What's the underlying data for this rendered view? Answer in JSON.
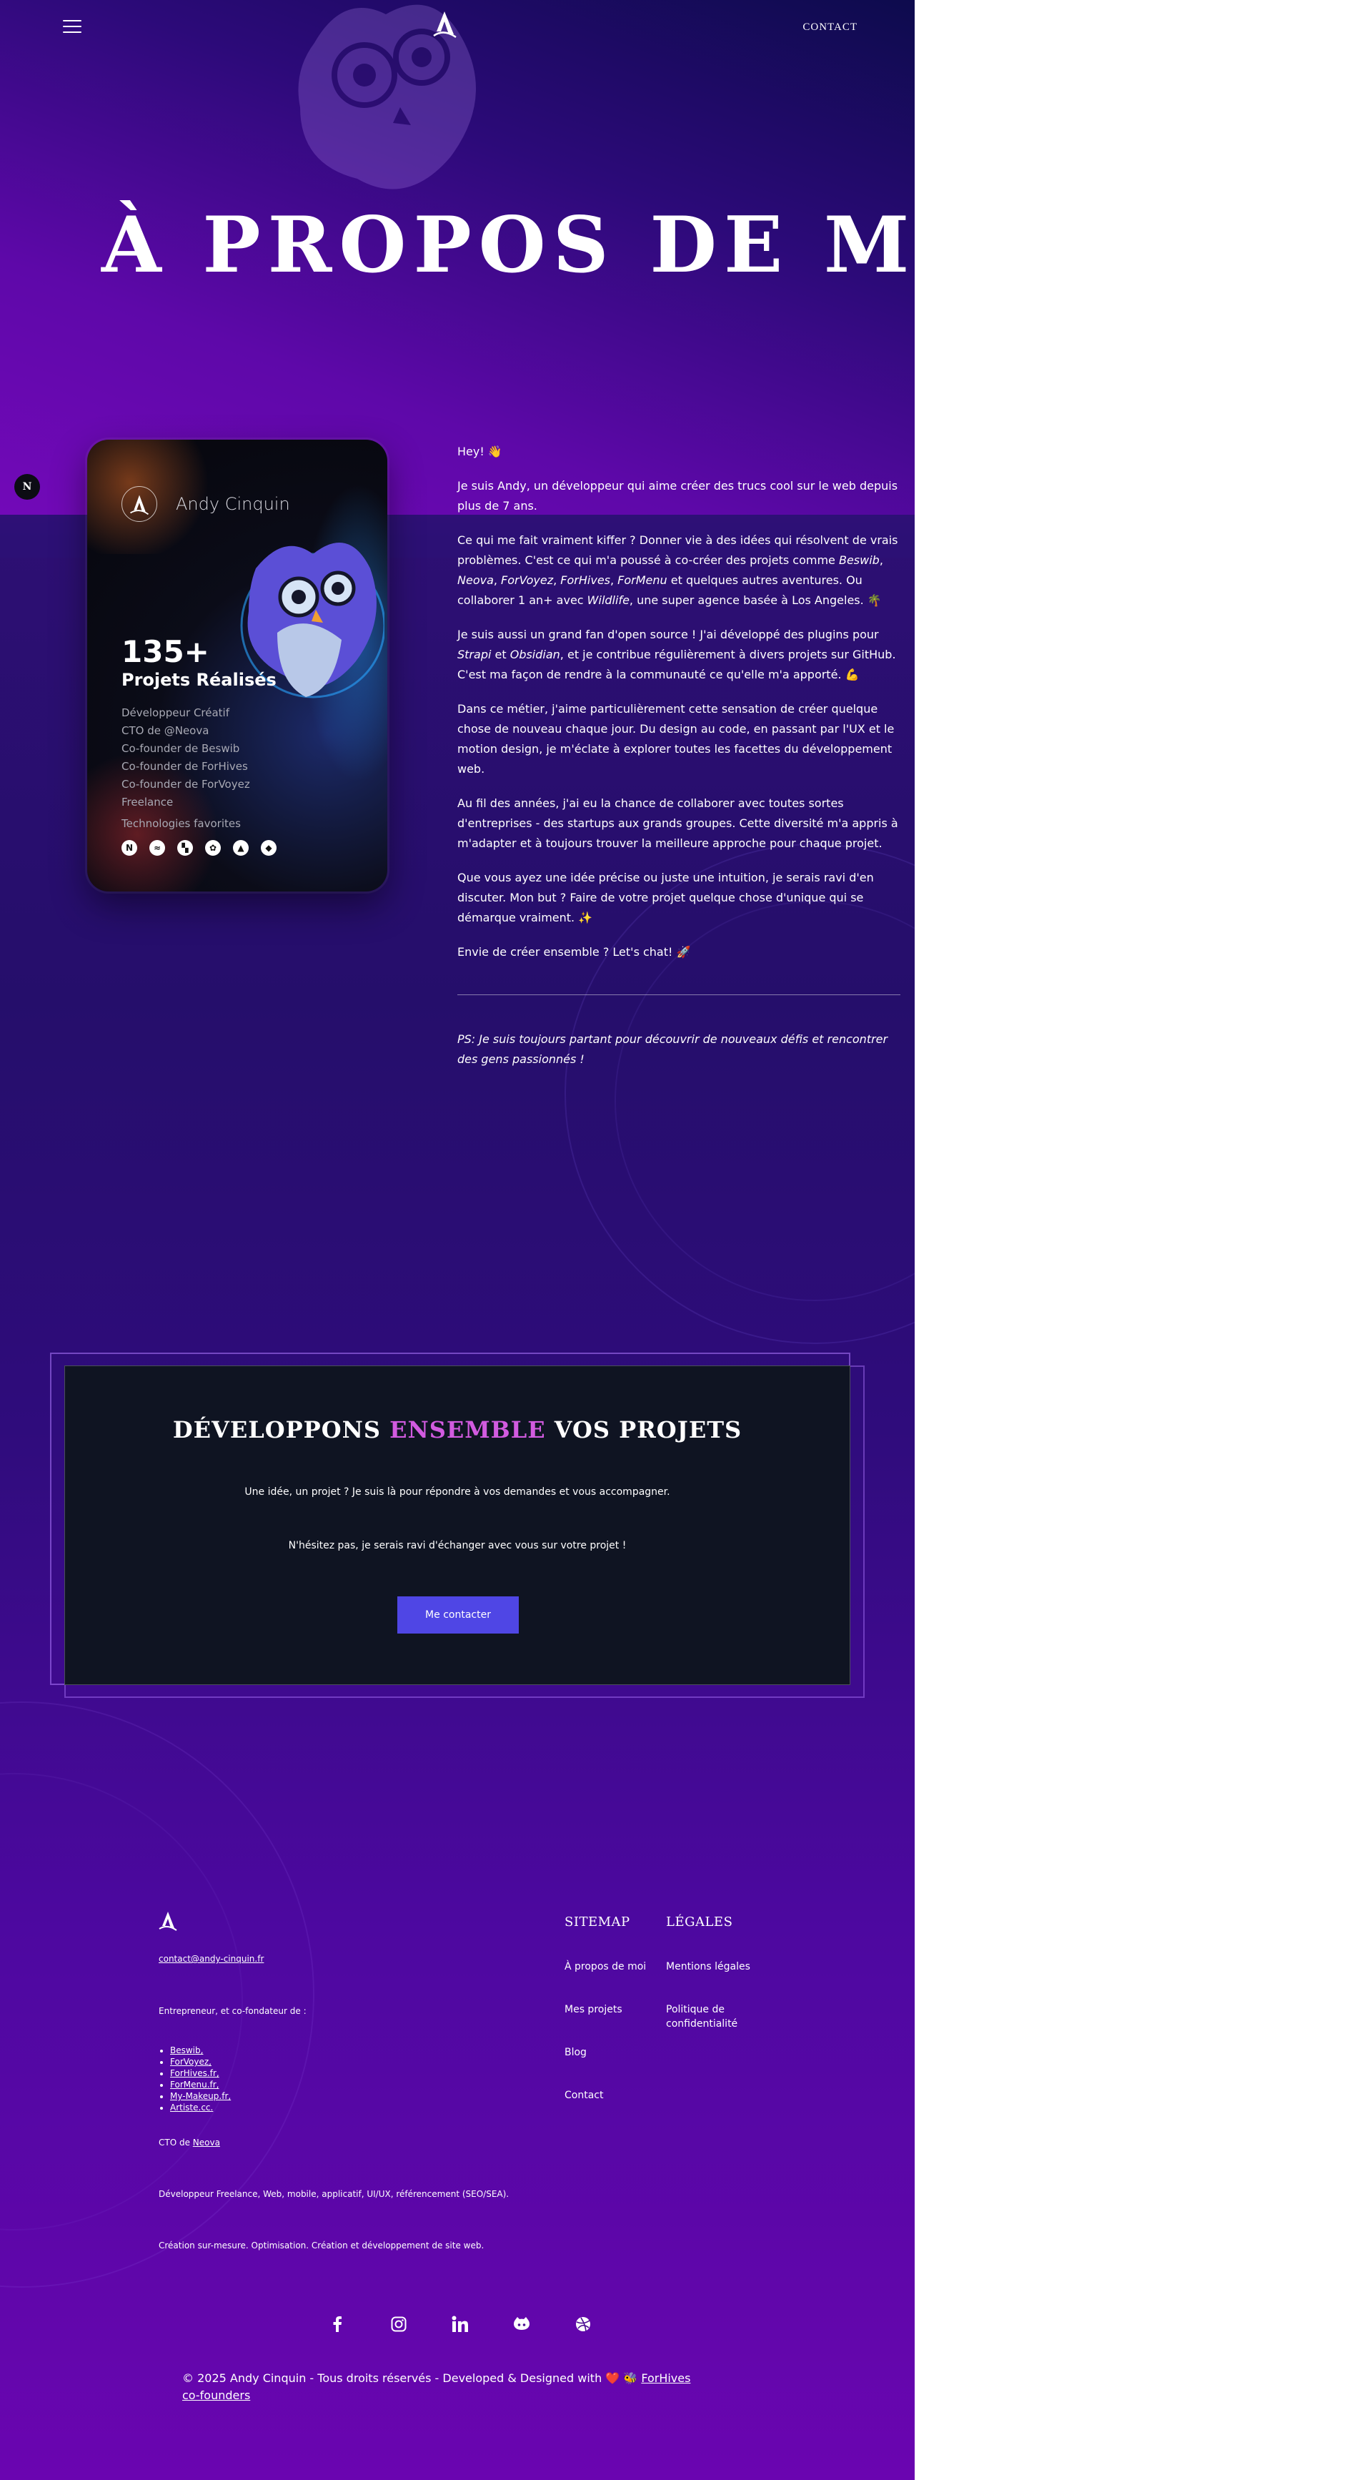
{
  "header": {
    "contact_label": "CONTACT"
  },
  "hero": {
    "title": "À PROPOS DE MOI"
  },
  "side_badge": {
    "label": "N"
  },
  "card": {
    "name": "Andy Cinquin",
    "count": "135+",
    "count_label": "Projets Réalisés",
    "roles": [
      "Développeur Créatif",
      "CTO de @Neova",
      "Co-founder de Beswib",
      "Co-founder de ForHives",
      "Co-founder de ForVoyez",
      "Freelance"
    ],
    "tech_label": "Technologies favorites",
    "tech_icons": [
      "nextjs-icon",
      "tailwind-icon",
      "strapi-icon",
      "openai-icon",
      "nuxt-icon",
      "prisma-icon"
    ]
  },
  "about": {
    "p1": "Hey! 👋",
    "p2": "Je suis Andy, un développeur qui aime créer des trucs cool sur le web depuis plus de 7 ans.",
    "p3_a": "Ce qui me fait vraiment kiffer ? Donner vie à des idées qui résolvent de vrais problèmes. C'est ce qui m'a poussé à co-créer des projets comme ",
    "p3_beswib": "Beswib",
    "p3_comma1": ", ",
    "p3_neova": "Neova",
    "p3_comma2": ", ",
    "p3_forvoyez": "ForVoyez",
    "p3_comma3": ", ",
    "p3_forhives": "ForHives",
    "p3_comma4": ", ",
    "p3_formenu": "ForMenu",
    "p3_b": " et quelques autres aventures. Ou collaborer 1 an+ avec ",
    "p3_wildlife": "Wildlife",
    "p3_c": ", une super agence basée à Los Angeles. 🌴",
    "p4_a": "Je suis aussi un grand fan d'open source ! J'ai développé des plugins pour ",
    "p4_strapi": "Strapi",
    "p4_b": " et ",
    "p4_obsidian": "Obsidian",
    "p4_c": ", et je contribue régulièrement à divers projets sur GitHub. C'est ma façon de rendre à la communauté ce qu'elle m'a apporté. 💪",
    "p5": "Dans ce métier, j'aime particulièrement cette sensation de créer quelque chose de nouveau chaque jour. Du design au code, en passant par l'UX et le motion design, je m'éclate à explorer toutes les facettes du développement web.",
    "p6": "Au fil des années, j'ai eu la chance de collaborer avec toutes sortes d'entreprises - des startups aux grands groupes. Cette diversité m'a appris à m'adapter et à toujours trouver la meilleure approche pour chaque projet.",
    "p7": "Que vous ayez une idée précise ou juste une intuition, je serais ravi d'en discuter. Mon but ? Faire de votre projet quelque chose d'unique qui se démarque vraiment. ✨",
    "p8": "Envie de créer ensemble ? Let's chat! 🚀",
    "ps": "PS: Je suis toujours partant pour découvrir de nouveaux défis et rencontrer des gens passionnés !"
  },
  "cta": {
    "title_a": "DÉVELOPPONS ",
    "title_accent": "ENSEMBLE",
    "title_b": " VOS PROJETS",
    "p1": "Une idée, un projet ? Je suis là pour répondre à vos demandes et vous accompagner.",
    "p2": "N'hésitez pas, je serais ravi d'échanger avec vous sur votre projet !",
    "button": "Me contacter",
    "accent_color": "#d25be0",
    "button_color": "#4f46e5"
  },
  "footer": {
    "email": "contact@andy-cinquin.fr",
    "entrepreneur": "Entrepreneur, et co-fondateur de :",
    "companies": [
      "Beswib,",
      "ForVoyez,",
      "ForHives.fr,",
      "ForMenu.fr,",
      "My-Makeup.fr,",
      "Artiste.cc."
    ],
    "cto_prefix": "CTO de ",
    "cto_company": "Neova",
    "dev_line": "Développeur Freelance, Web, mobile, applicatif, UI/UX, référencement (SEO/SEA).",
    "creation_line": "Création sur-mesure. Optimisation. Création et développement de site web.",
    "sitemap_title": "SITEMAP",
    "sitemap_links": [
      "À propos de moi",
      "Mes projets",
      "Blog",
      "Contact"
    ],
    "legal_title": "LÉGALES",
    "legal_links": [
      "Mentions légales",
      "Politique de confidentialité"
    ],
    "socials": [
      "facebook-icon",
      "instagram-icon",
      "linkedin-icon",
      "github-icon",
      "dribbble-icon"
    ],
    "copyright_text": "© 2025 Andy Cinquin - Tous droits réservés - Developed & Designed with ❤️ 🐝 ",
    "copyright_link": "ForHives co-founders"
  },
  "colors": {
    "page_top": "#6b07b3",
    "page_mid": "#250e6b",
    "page_bottom": "#6a05b0",
    "cta_bg": "#0f1422"
  }
}
